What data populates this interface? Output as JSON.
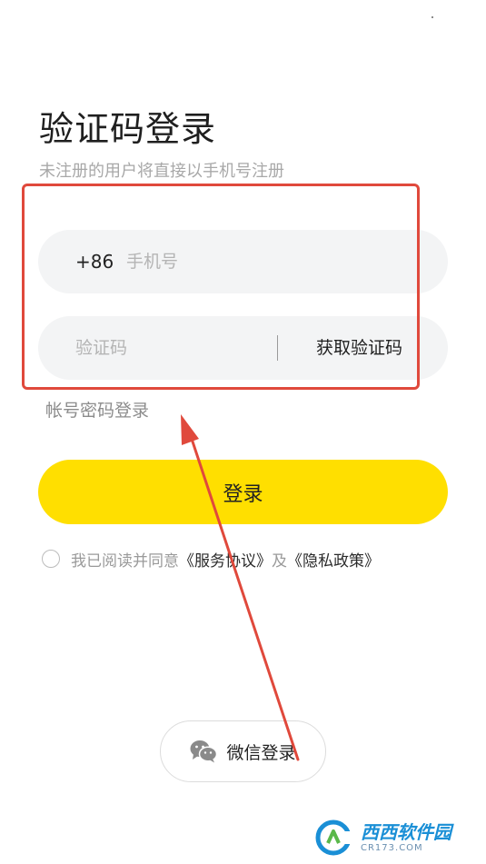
{
  "header": {
    "title": "验证码登录",
    "subtitle": "未注册的用户将直接以手机号注册"
  },
  "phone_field": {
    "prefix": "+86",
    "placeholder": "手机号",
    "value": ""
  },
  "code_field": {
    "placeholder": "验证码",
    "value": "",
    "get_code_label": "获取验证码"
  },
  "alt_login_label": "帐号密码登录",
  "login_button_label": "登录",
  "agreement": {
    "checked": false,
    "prefix": "我已阅读并同意",
    "service_link": "《服务协议》",
    "conjunction": "及",
    "privacy_link": "《隐私政策》"
  },
  "wechat": {
    "label": "微信登录",
    "icon": "wechat-icon"
  },
  "watermark": {
    "brand": "西西软件园",
    "domain": "CR173.COM"
  },
  "colors": {
    "accent": "#ffdf00",
    "annotation": "#e0493c",
    "field_bg": "#f3f4f5",
    "placeholder": "#b4b4b4"
  }
}
